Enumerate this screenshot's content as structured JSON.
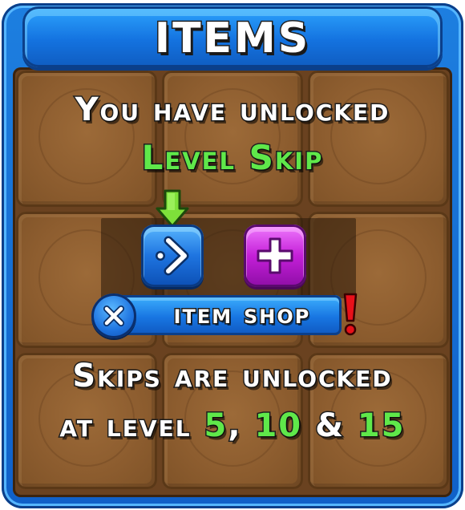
{
  "header": {
    "title": "ITEMS"
  },
  "unlock_message": {
    "line1": "You have unlocked",
    "item_name": "Level Skip"
  },
  "buttons": {
    "level_skip": {
      "icon": "level-skip-icon",
      "color": "#1e74e0"
    },
    "plus": {
      "icon": "plus-icon",
      "color": "#c41fd8"
    }
  },
  "item_shop": {
    "label": "item shop",
    "close_icon": "close-icon",
    "alert_icon": "exclamation-icon",
    "alert_color": "#e8101a"
  },
  "info": {
    "line1": "Skips are unlocked",
    "line2_prefix": "at level",
    "levels": [
      "5",
      "10",
      "15"
    ],
    "separator_comma": ",",
    "separator_and": "&"
  },
  "colors": {
    "accent_green": "#5fe84a",
    "frame_blue": "#1473e0",
    "board_brown": "#8d5d2f"
  }
}
